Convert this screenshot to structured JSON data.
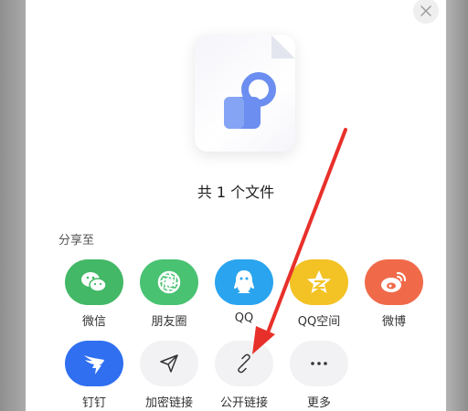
{
  "file": {
    "count_text": "共 1 个文件"
  },
  "share": {
    "title": "分享至",
    "row1": [
      {
        "label": "微信",
        "icon": "wechat-icon",
        "color": "#43b866"
      },
      {
        "label": "朋友圈",
        "icon": "moments-icon",
        "color": "#49c272"
      },
      {
        "label": "QQ",
        "icon": "qq-icon",
        "color": "#2aa4ee"
      },
      {
        "label": "QQ空间",
        "icon": "qzone-icon",
        "color": "#f3c224"
      },
      {
        "label": "微博",
        "icon": "weibo-icon",
        "color": "#f06a4a"
      }
    ],
    "row2": [
      {
        "label": "钉钉",
        "icon": "dingtalk-icon",
        "color": "#2f6ff0"
      },
      {
        "label": "加密链接",
        "icon": "send-icon",
        "color": "#f2f2f4"
      },
      {
        "label": "公开链接",
        "icon": "link-icon",
        "color": "#f2f2f4"
      },
      {
        "label": "更多",
        "icon": "more-icon",
        "color": "#f2f2f4"
      }
    ]
  },
  "colors": {
    "annotation_arrow": "#e8302a",
    "file_icon": "#6b8ef0"
  }
}
